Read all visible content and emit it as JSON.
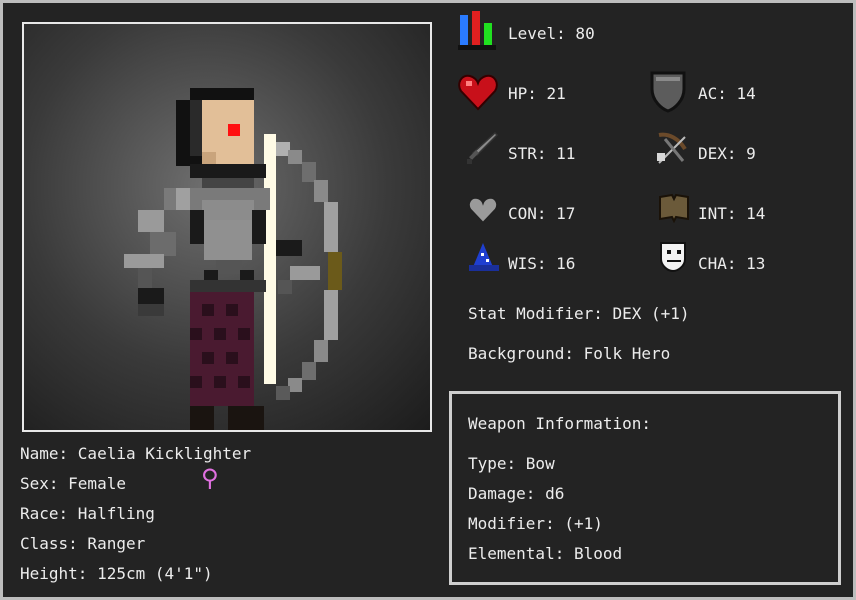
{
  "stats": {
    "level": "Level: 80",
    "hp": "HP: 21",
    "ac": "AC: 14",
    "str": "STR: 11",
    "dex": "DEX: 9",
    "con": "CON: 17",
    "int": "INT: 14",
    "wis": "WIS: 16",
    "cha": "CHA: 13"
  },
  "modifier": "Stat Modifier: DEX (+1)",
  "background": "Background: Folk Hero",
  "character": {
    "name": "Name: Caelia Kicklighter",
    "sex": "Sex: Female",
    "race": "Race: Halfling",
    "class": "Class: Ranger",
    "height": "Height: 125cm (4'1\")",
    "sex_symbol": "⚲"
  },
  "weapon": {
    "heading": "Weapon Information:",
    "type": "Type: Bow",
    "damage": "Damage: d6",
    "modifier": "Modifier: (+1)",
    "elemental": "Elemental: Blood"
  },
  "colors": {
    "panel": "#232323",
    "border": "#bdbdbd",
    "sex_symbol": "#e070e0"
  }
}
